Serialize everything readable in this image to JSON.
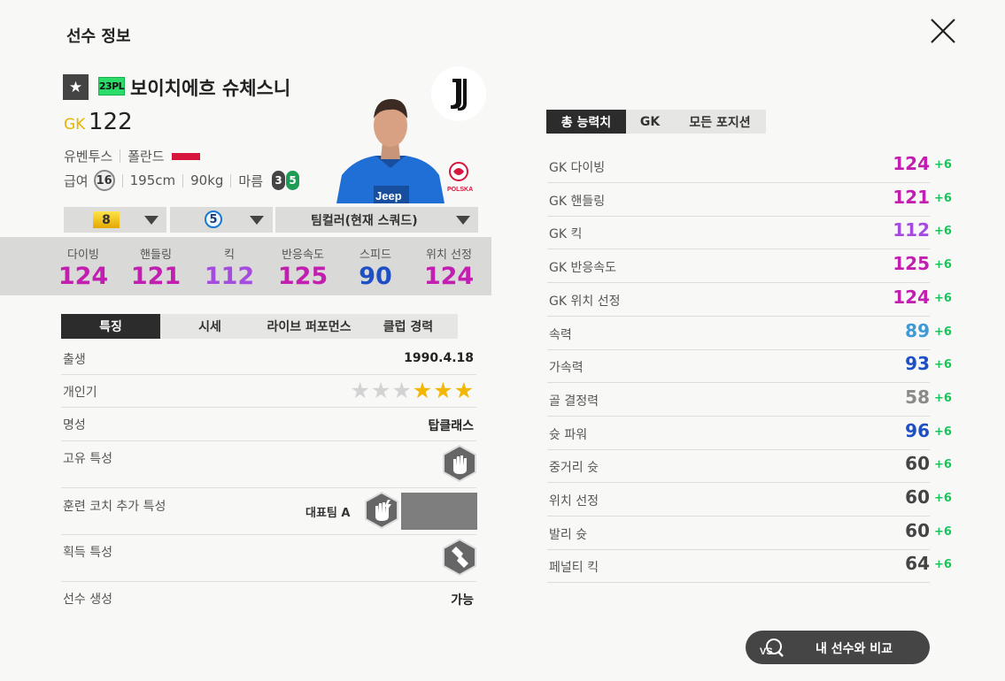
{
  "page": {
    "title": "선수 정보"
  },
  "colors": {
    "gold": "#e8b400",
    "magenta": "#c21fb0",
    "violet": "#a64be0",
    "blue": "#1f4fc4",
    "sky": "#3d9ad6",
    "gray": "#8a8a8a",
    "dark": "#444444",
    "bonus": "#16c45a",
    "flag": "#d6163c"
  },
  "player": {
    "season_badge": "23PL",
    "name": "보이치에흐 슈체스니",
    "position": "GK",
    "ovr": "122",
    "club": "유벤투스",
    "nation": "폴란드",
    "pay_label": "급여",
    "pay": "16",
    "height": "195cm",
    "weight": "90kg",
    "body_type": "마름",
    "weak_foot": "3",
    "strong_foot": "5",
    "kit_text": "Jeep",
    "nation_logo_text": "POLSKA"
  },
  "selectors": {
    "upgrade": "8",
    "skill": "5",
    "team_color": "팀컬러(현재 스쿼드)"
  },
  "summary_stats": [
    {
      "label": "다이빙",
      "value": "124",
      "color": "magenta"
    },
    {
      "label": "핸들링",
      "value": "121",
      "color": "magenta"
    },
    {
      "label": "킥",
      "value": "112",
      "color": "violet"
    },
    {
      "label": "반응속도",
      "value": "125",
      "color": "magenta"
    },
    {
      "label": "스피드",
      "value": "90",
      "color": "blue"
    },
    {
      "label": "위치 선정",
      "value": "124",
      "color": "magenta"
    }
  ],
  "tabs": [
    "특징",
    "시세",
    "라이브 퍼포먼스",
    "클럽 경력"
  ],
  "details": {
    "birth_label": "출생",
    "birth": "1990.4.18",
    "popularity_label": "개인기",
    "popularity_stars": 3,
    "popularity_max": 6,
    "reputation_label": "명성",
    "reputation": "탑클래스",
    "unique_trait_label": "고유 특성",
    "unique_trait_icon": "goalkeeper-glove-icon",
    "coach_trait_label": "훈련 코치 추가 특성",
    "coach_trait_value": "대표팀 A",
    "coach_trait_icon": "lightning-glove-icon",
    "acquired_trait_label": "획득 특성",
    "acquired_trait_icon": "glove-save-icon",
    "create_label": "선수 생성",
    "create": "가능"
  },
  "right_tabs": [
    "총 능력치",
    "GK",
    "모든 포지션"
  ],
  "attributes": [
    {
      "name": "GK 다이빙",
      "value": "124",
      "bonus": "+6",
      "color": "magenta"
    },
    {
      "name": "GK 핸들링",
      "value": "121",
      "bonus": "+6",
      "color": "magenta"
    },
    {
      "name": "GK 킥",
      "value": "112",
      "bonus": "+6",
      "color": "violet"
    },
    {
      "name": "GK 반응속도",
      "value": "125",
      "bonus": "+6",
      "color": "magenta"
    },
    {
      "name": "GK 위치 선정",
      "value": "124",
      "bonus": "+6",
      "color": "magenta"
    },
    {
      "name": "속력",
      "value": "89",
      "bonus": "+6",
      "color": "sky"
    },
    {
      "name": "가속력",
      "value": "93",
      "bonus": "+6",
      "color": "blue"
    },
    {
      "name": "골 결정력",
      "value": "58",
      "bonus": "+6",
      "color": "gray"
    },
    {
      "name": "슛 파워",
      "value": "96",
      "bonus": "+6",
      "color": "blue"
    },
    {
      "name": "중거리 슛",
      "value": "60",
      "bonus": "+6",
      "color": "dark"
    },
    {
      "name": "위치 선정",
      "value": "60",
      "bonus": "+6",
      "color": "dark"
    },
    {
      "name": "발리 슛",
      "value": "60",
      "bonus": "+6",
      "color": "dark"
    },
    {
      "name": "페널티 킥",
      "value": "64",
      "bonus": "+6",
      "color": "dark"
    }
  ],
  "compare": {
    "icon_text": "VS",
    "label": "내 선수와 비교"
  }
}
